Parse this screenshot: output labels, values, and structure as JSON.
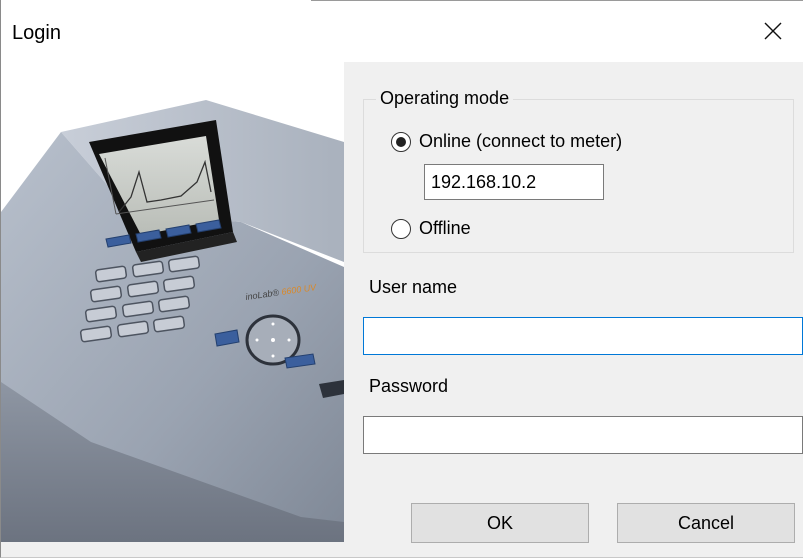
{
  "window": {
    "title": "Login",
    "close_icon": "close-icon"
  },
  "device_image": {
    "name": "meter-device-picture",
    "brand_text": "inoLab® 6600 UV/Vis"
  },
  "operating_mode": {
    "legend": "Operating mode",
    "options": [
      {
        "label": "Online (connect to meter)",
        "selected": true
      },
      {
        "label": "Offline",
        "selected": false
      }
    ],
    "ip_address": "192.168.10.2"
  },
  "user_name": {
    "label": "User name",
    "value": ""
  },
  "password": {
    "label": "Password",
    "value": ""
  },
  "buttons": {
    "ok": "OK",
    "cancel": "Cancel"
  },
  "colors": {
    "focus_border": "#0078d7",
    "button_bg": "#e1e1e1",
    "dialog_bg": "#f0f0f0"
  }
}
